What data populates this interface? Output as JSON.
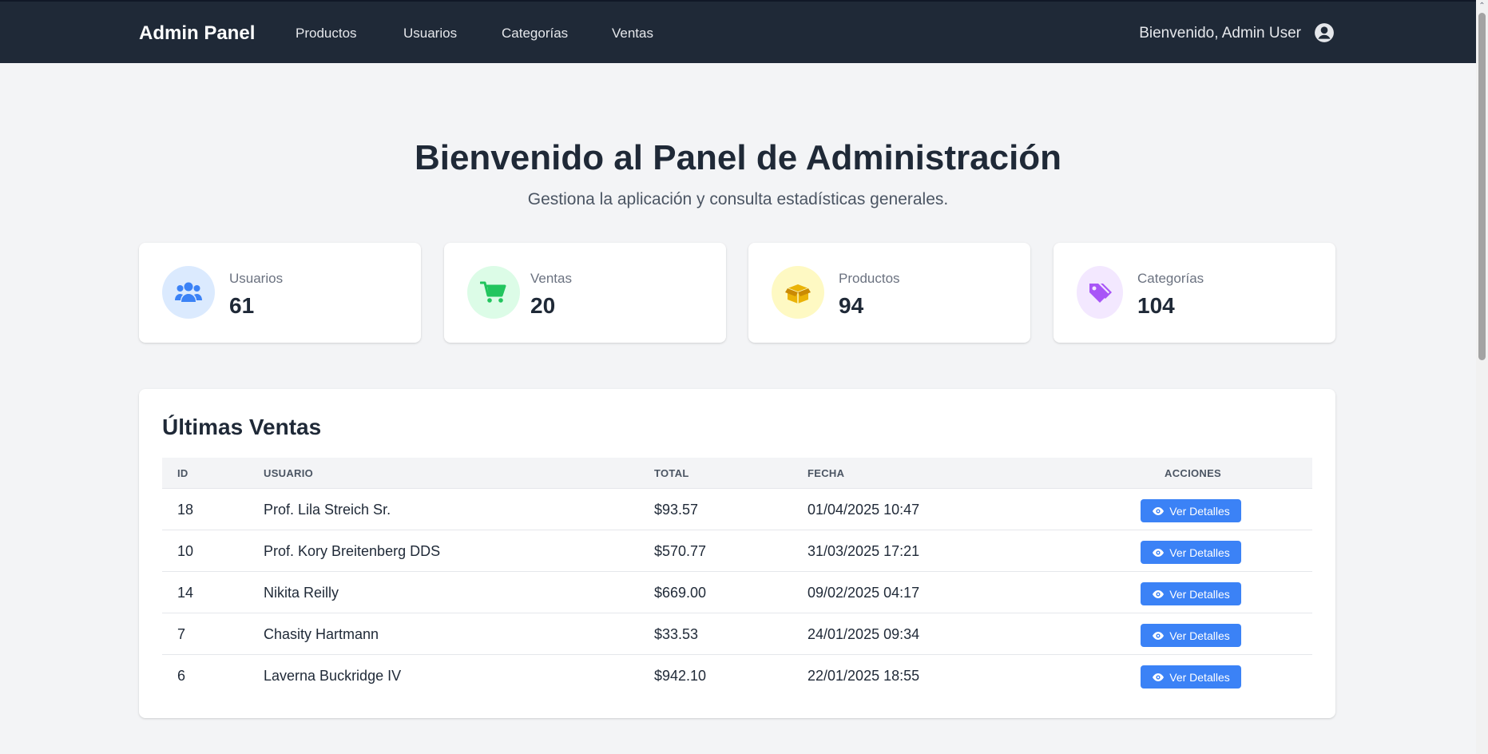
{
  "navbar": {
    "brand": "Admin Panel",
    "links": [
      "Productos",
      "Usuarios",
      "Categorías",
      "Ventas"
    ],
    "welcome": "Bienvenido, Admin User",
    "user_icon": "user-circle-icon"
  },
  "hero": {
    "title": "Bienvenido al Panel de Administración",
    "subtitle": "Gestiona la aplicación y consulta estadísticas generales."
  },
  "stats": [
    {
      "label": "Usuarios",
      "value": "61",
      "icon": "users-icon",
      "color": "#3b82f6",
      "bg": "#dbeafe"
    },
    {
      "label": "Ventas",
      "value": "20",
      "icon": "shopping-cart-icon",
      "color": "#22c55e",
      "bg": "#dcfce7"
    },
    {
      "label": "Productos",
      "value": "94",
      "icon": "box-icon",
      "color": "#eab308",
      "bg": "#fef9c3"
    },
    {
      "label": "Categorías",
      "value": "104",
      "icon": "tags-icon",
      "color": "#a855f7",
      "bg": "#f3e8ff"
    }
  ],
  "sales": {
    "title": "Últimas Ventas",
    "columns": [
      "ID",
      "USUARIO",
      "TOTAL",
      "FECHA",
      "ACCIONES"
    ],
    "rows": [
      {
        "id": "18",
        "user": "Prof. Lila Streich Sr.",
        "total": "$93.57",
        "date": "01/04/2025 10:47",
        "action": "Ver Detalles"
      },
      {
        "id": "10",
        "user": "Prof. Kory Breitenberg DDS",
        "total": "$570.77",
        "date": "31/03/2025 17:21",
        "action": "Ver Detalles"
      },
      {
        "id": "14",
        "user": "Nikita Reilly",
        "total": "$669.00",
        "date": "09/02/2025 04:17",
        "action": "Ver Detalles"
      },
      {
        "id": "7",
        "user": "Chasity Hartmann",
        "total": "$33.53",
        "date": "24/01/2025 09:34",
        "action": "Ver Detalles"
      },
      {
        "id": "6",
        "user": "Laverna Buckridge IV",
        "total": "$942.10",
        "date": "22/01/2025 18:55",
        "action": "Ver Detalles"
      }
    ],
    "action_icon": "eye-icon",
    "action_color": "#3b82f6"
  }
}
